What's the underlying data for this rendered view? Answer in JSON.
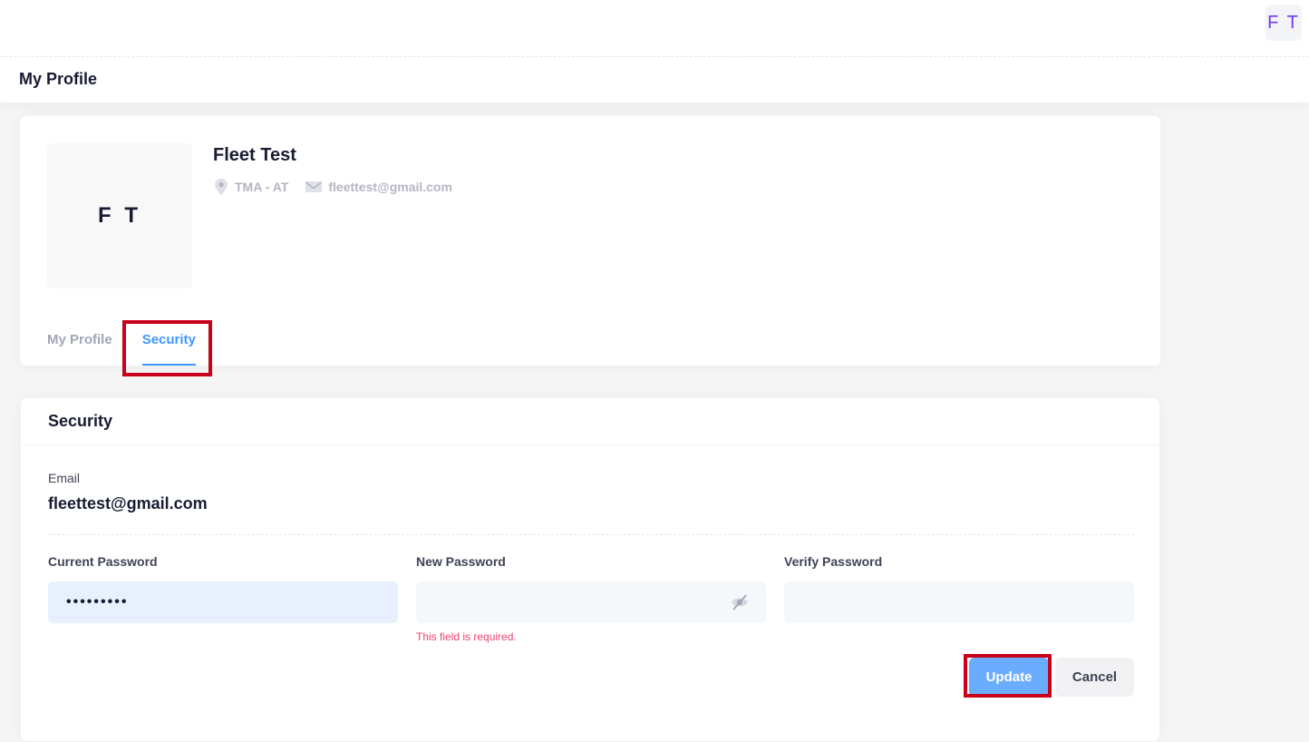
{
  "header": {
    "avatar_initials": "F T"
  },
  "toolbar": {
    "title": "My Profile"
  },
  "profile": {
    "avatar_initials": "F T",
    "name": "Fleet Test",
    "location": "TMA - AT",
    "email": "fleettest@gmail.com",
    "tabs": [
      {
        "label": "My Profile",
        "active": false
      },
      {
        "label": "Security",
        "active": true
      }
    ]
  },
  "security": {
    "title": "Security",
    "email_label": "Email",
    "email_value": "fleettest@gmail.com",
    "current_password": {
      "label": "Current Password",
      "value": "•••••••••"
    },
    "new_password": {
      "label": "New Password",
      "value": "",
      "error": "This field is required."
    },
    "verify_password": {
      "label": "Verify Password",
      "value": ""
    },
    "update_label": "Update",
    "cancel_label": "Cancel"
  },
  "colors": {
    "accent": "#3e97ff",
    "highlight": "#c8001a",
    "error": "#f1416c",
    "update_button": "#6aadff"
  },
  "icons": {
    "location": "map-marker-icon",
    "email": "envelope-icon",
    "password_visibility": "eye-slash-icon"
  }
}
